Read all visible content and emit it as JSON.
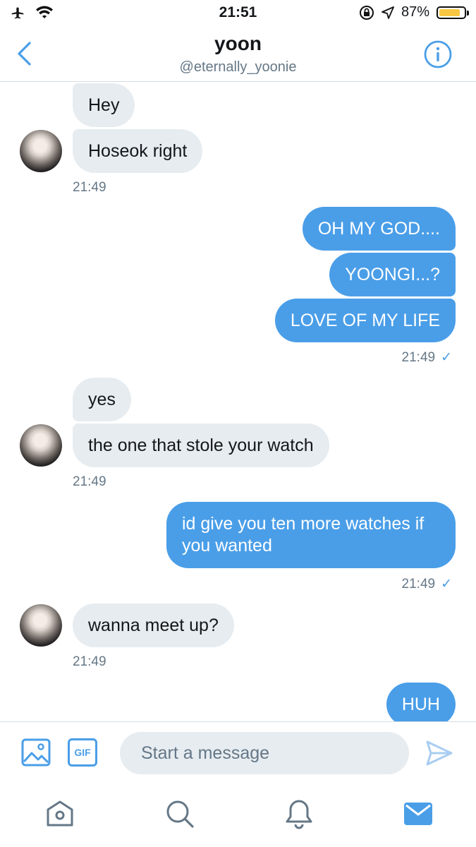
{
  "status": {
    "time": "21:51",
    "battery": "87%",
    "battery_level": 0.87
  },
  "header": {
    "name": "yoon",
    "handle": "@eternally_yoonie"
  },
  "messages": {
    "m1": "Hey",
    "m2": "Hoseok right",
    "t1": "21:49",
    "m3": "OH MY GOD....",
    "m4": "YOONGI...?",
    "m5": "LOVE OF MY LIFE",
    "t2": "21:49",
    "m6": "yes",
    "m7": "the one that stole your watch",
    "t3": "21:49",
    "m8": "id give you ten more watches if you wanted",
    "t4": "21:49",
    "m9": "wanna meet up?",
    "t5": "21:49",
    "m10": "HUH"
  },
  "composer": {
    "placeholder": "Start a message",
    "gif_label": "GIF"
  },
  "colors": {
    "accent": "#4a9ee8",
    "incoming_bubble": "#e6ecf0",
    "battery": "#f7c744"
  },
  "icons": {
    "status": [
      "airplane-icon",
      "wifi-icon",
      "orientation-lock-icon",
      "location-icon",
      "battery-icon"
    ],
    "header": [
      "back-chevron-icon",
      "info-icon"
    ],
    "composer": [
      "image-icon",
      "gif-icon",
      "send-icon"
    ],
    "tabbar": [
      "home-icon",
      "search-icon",
      "notifications-icon",
      "messages-icon"
    ]
  }
}
